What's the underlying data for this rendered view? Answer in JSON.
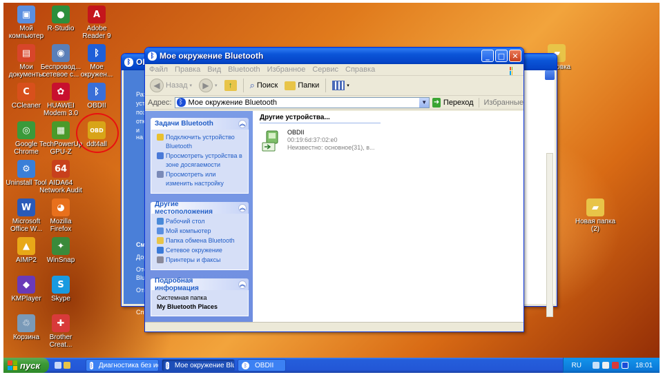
{
  "desktop": {
    "icons": [
      {
        "label": "Мой компьютер",
        "glyph": "▣",
        "color": "#5a8fe0"
      },
      {
        "label": "R-Studio",
        "glyph": "●",
        "color": "#2c8f3c"
      },
      {
        "label": "Adobe Reader 9",
        "glyph": "A",
        "color": "#c4161c"
      },
      {
        "label": "Мои документы",
        "glyph": "▤",
        "color": "#d8452a"
      },
      {
        "label": "Беспровод... сетевое с...",
        "glyph": "◉",
        "color": "#5a7fb8"
      },
      {
        "label": "Мое окружен...",
        "glyph": "ᛒ",
        "color": "#1f5fd8"
      },
      {
        "label": "CCleaner",
        "glyph": "C",
        "color": "#d8501c"
      },
      {
        "label": "HUAWEI Modem 3.0",
        "glyph": "✿",
        "color": "#c8102e"
      },
      {
        "label": "OBDII",
        "glyph": "ᛒ",
        "color": "#3a6fd8"
      },
      {
        "label": "Google Chrome",
        "glyph": "◎",
        "color": "#3a9a3a"
      },
      {
        "label": "TechPowerUp GPU-Z",
        "glyph": "▦",
        "color": "#4a9a2a"
      },
      {
        "label": "ddt4all",
        "glyph": "OBD",
        "color": "#d8a418"
      },
      {
        "label": "Uninstall Tool",
        "glyph": "⚙",
        "color": "#3a7fd8"
      },
      {
        "label": "AIDA64 Network Audit",
        "glyph": "64",
        "color": "#c8401c"
      },
      {
        "label": "Microsoft Office W...",
        "glyph": "W",
        "color": "#2a5ab8"
      },
      {
        "label": "Mozilla Firefox",
        "glyph": "◕",
        "color": "#e8701c"
      },
      {
        "label": "AIMP2",
        "glyph": "▲",
        "color": "#e8a818"
      },
      {
        "label": "WinSnap",
        "glyph": "✦",
        "color": "#3a8a3a"
      },
      {
        "label": "KMPlayer",
        "glyph": "◆",
        "color": "#6a3ab8"
      },
      {
        "label": "Skype",
        "glyph": "S",
        "color": "#1a9ae0"
      },
      {
        "label": "Корзина",
        "glyph": "♲",
        "color": "#7a9ab8"
      },
      {
        "label": "Brother Creat...",
        "glyph": "✚",
        "color": "#d83a3a"
      },
      {
        "label": "Новая папка (2)",
        "glyph": "▰",
        "color": "#e8c448"
      },
      {
        "label": "...оровка",
        "glyph": "▰",
        "color": "#e8c448"
      }
    ]
  },
  "back_window": {
    "title": "OBDII",
    "left_texts": [
      "Раз",
      "устр",
      "поз",
      "отк",
      "и на",
      "См.",
      "Дор",
      "Отс",
      "Blue",
      "Отк",
      "Спр"
    ]
  },
  "main_window": {
    "title": "Мое окружение Bluetooth",
    "menu": [
      "Файл",
      "Правка",
      "Вид",
      "Bluetooth",
      "Избранное",
      "Сервис",
      "Справка"
    ],
    "toolbar": {
      "back": "Назад",
      "search": "Поиск",
      "folders": "Папки"
    },
    "address": {
      "label": "Адрес:",
      "value": "Мое окружение Bluetooth",
      "go": "Переход",
      "favorites": "Избранные"
    },
    "panels": [
      {
        "title": "Задачи Bluetooth",
        "items": [
          {
            "text": "Подключить устройство Bluetooth",
            "icon_color": "#e8c030"
          },
          {
            "text": "Просмотреть устройства в зоне досягаемости",
            "icon_color": "#4a7ad8"
          },
          {
            "text": "Просмотреть или изменить настройку",
            "icon_color": "#7a8ab8"
          }
        ]
      },
      {
        "title": "Другие местоположения",
        "items": [
          {
            "text": "Рабочий стол",
            "icon_color": "#4a8ad8"
          },
          {
            "text": "Мой компьютер",
            "icon_color": "#5a8fe0"
          },
          {
            "text": "Папка обмена Bluetooth",
            "icon_color": "#e8c448"
          },
          {
            "text": "Сетевое окружение",
            "icon_color": "#3a7ad8"
          },
          {
            "text": "Принтеры и факсы",
            "icon_color": "#8a8a9a"
          }
        ]
      }
    ],
    "details": {
      "title": "Подробная информация",
      "line1": "Системная папка",
      "line2": "My Bluetooth Places"
    },
    "group_header": "Другие устройства...",
    "device": {
      "name": "OBDII",
      "address": "00:19:6d:37:02:e0",
      "info": "Неизвестно: основное(31), в..."
    }
  },
  "taskbar": {
    "start": "пуск",
    "tasks": [
      {
        "label": "Диагностика без ис...",
        "active": false
      },
      {
        "label": "Мое окружение Blue...",
        "active": true
      },
      {
        "label": "OBDII",
        "active": false
      }
    ],
    "lang": "RU",
    "clock": "18:01"
  }
}
